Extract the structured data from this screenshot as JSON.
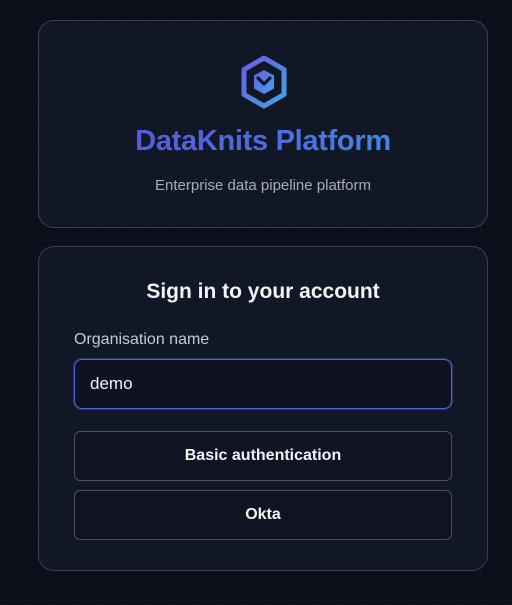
{
  "brand": {
    "logo_icon": "hexagon-logo-icon",
    "title": "DataKnits Platform",
    "subtitle": "Enterprise data pipeline platform",
    "colors": {
      "gradient_start": "#5b4fd9",
      "gradient_end": "#3d9be0"
    }
  },
  "login": {
    "heading": "Sign in to your account",
    "org_label": "Organisation name",
    "org_value": "demo",
    "buttons": {
      "basic": "Basic authentication",
      "okta": "Okta"
    }
  },
  "colors": {
    "background": "#0b0f1a",
    "card": "#121726",
    "input_focus_border": "#4f62e0"
  }
}
